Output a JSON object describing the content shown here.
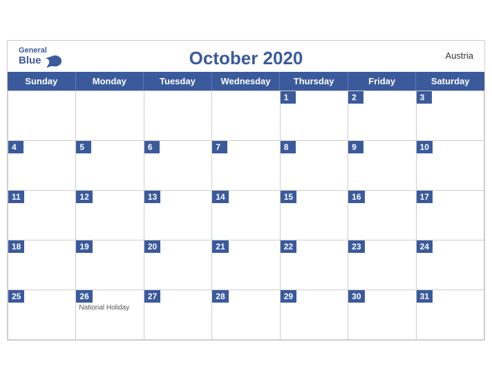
{
  "header": {
    "logo_general": "General",
    "logo_blue": "Blue",
    "title": "October 2020",
    "country": "Austria"
  },
  "days": [
    "Sunday",
    "Monday",
    "Tuesday",
    "Wednesday",
    "Thursday",
    "Friday",
    "Saturday"
  ],
  "weeks": [
    [
      {
        "num": "",
        "holiday": ""
      },
      {
        "num": "",
        "holiday": ""
      },
      {
        "num": "",
        "holiday": ""
      },
      {
        "num": "",
        "holiday": ""
      },
      {
        "num": "1",
        "holiday": ""
      },
      {
        "num": "2",
        "holiday": ""
      },
      {
        "num": "3",
        "holiday": ""
      }
    ],
    [
      {
        "num": "4",
        "holiday": ""
      },
      {
        "num": "5",
        "holiday": ""
      },
      {
        "num": "6",
        "holiday": ""
      },
      {
        "num": "7",
        "holiday": ""
      },
      {
        "num": "8",
        "holiday": ""
      },
      {
        "num": "9",
        "holiday": ""
      },
      {
        "num": "10",
        "holiday": ""
      }
    ],
    [
      {
        "num": "11",
        "holiday": ""
      },
      {
        "num": "12",
        "holiday": ""
      },
      {
        "num": "13",
        "holiday": ""
      },
      {
        "num": "14",
        "holiday": ""
      },
      {
        "num": "15",
        "holiday": ""
      },
      {
        "num": "16",
        "holiday": ""
      },
      {
        "num": "17",
        "holiday": ""
      }
    ],
    [
      {
        "num": "18",
        "holiday": ""
      },
      {
        "num": "19",
        "holiday": ""
      },
      {
        "num": "20",
        "holiday": ""
      },
      {
        "num": "21",
        "holiday": ""
      },
      {
        "num": "22",
        "holiday": ""
      },
      {
        "num": "23",
        "holiday": ""
      },
      {
        "num": "24",
        "holiday": ""
      }
    ],
    [
      {
        "num": "25",
        "holiday": ""
      },
      {
        "num": "26",
        "holiday": "National Holiday"
      },
      {
        "num": "27",
        "holiday": ""
      },
      {
        "num": "28",
        "holiday": ""
      },
      {
        "num": "29",
        "holiday": ""
      },
      {
        "num": "30",
        "holiday": ""
      },
      {
        "num": "31",
        "holiday": ""
      }
    ]
  ]
}
